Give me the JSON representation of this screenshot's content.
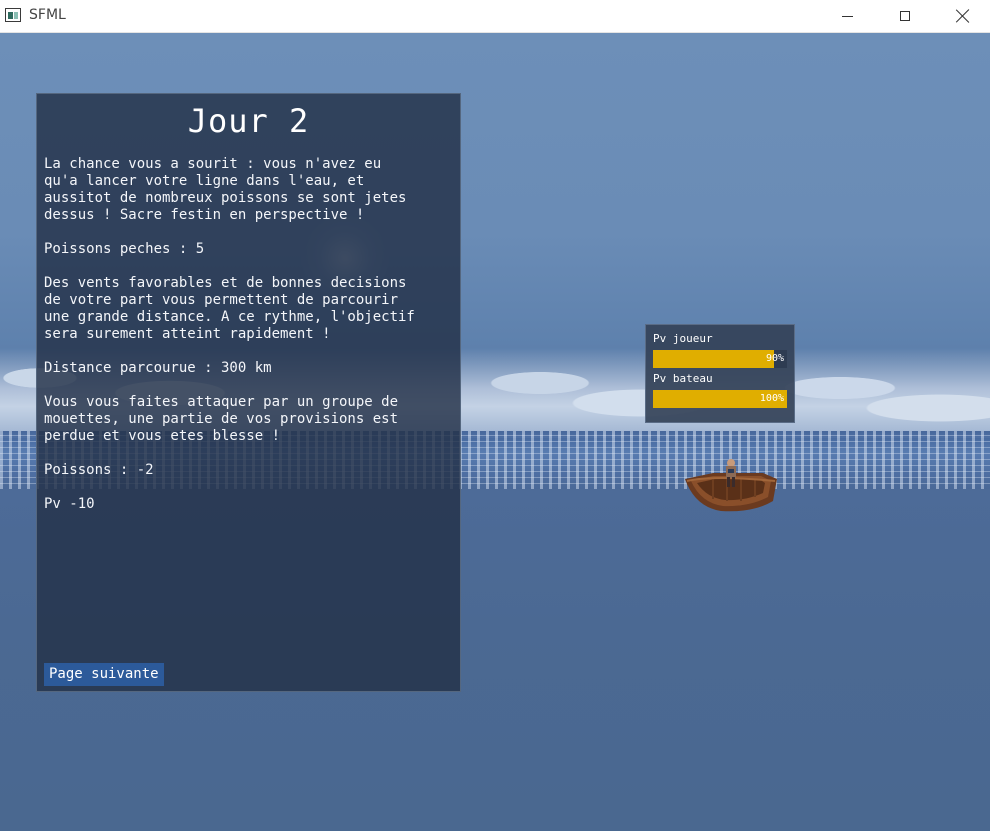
{
  "window": {
    "title": "SFML",
    "controls": {
      "minimize": "minimize-icon",
      "maximize": "maximize-icon",
      "close": "close-icon"
    }
  },
  "dialog": {
    "title": "Jour 2",
    "paragraphs": [
      "La chance vous a sourit : vous n'avez eu\nqu'a lancer votre ligne dans l'eau, et\naussitot de nombreux poissons se sont jetes\ndessus ! Sacre festin en perspective !",
      "Poissons peches : 5",
      "Des vents favorables et de bonnes decisions\nde votre part vous permettent de parcourir\nune grande distance. A ce rythme, l'objectif\nsera surement atteint rapidement !",
      "Distance parcourue : 300 km",
      "Vous vous faites attaquer par un groupe de\nmouettes, une partie de vos provisions est\nperdue et vous etes blesse !",
      "Poissons : -2",
      "Pv -10"
    ],
    "next_button": "Page suivante"
  },
  "status": {
    "player_label": "Pv joueur",
    "player_value": "90%",
    "player_fraction": 0.9,
    "boat_label": "Pv bateau",
    "boat_value": "100%",
    "boat_fraction": 1.0,
    "bar_color": "#e0ae00"
  }
}
